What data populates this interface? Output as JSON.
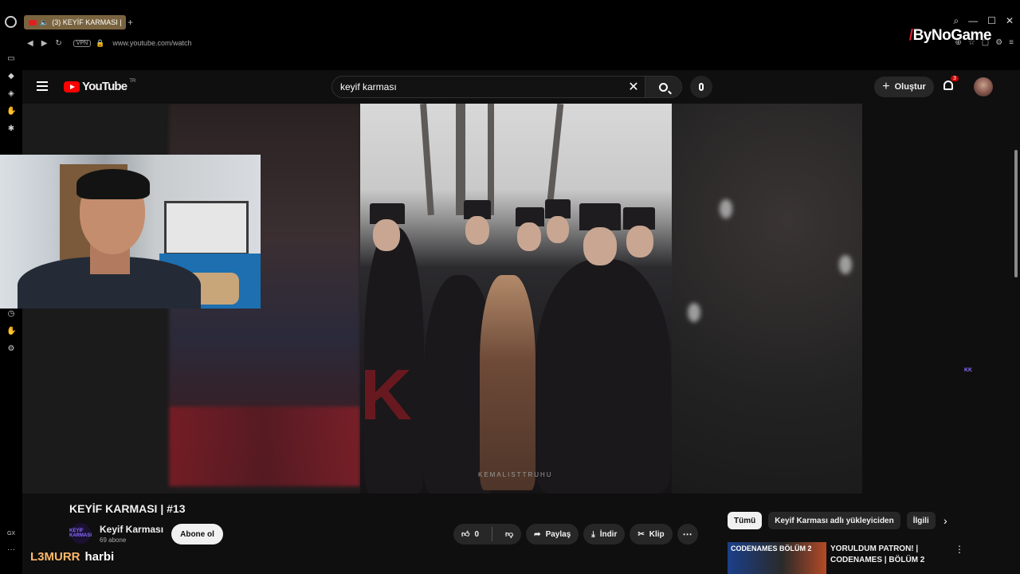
{
  "browser": {
    "tab_title": "(3) KEYİF KARMASI |",
    "url": "www.youtube.com/watch",
    "vpn_label": "VPN",
    "watermark": "ByNoGame",
    "rail_labels": [
      "GX",
      "···"
    ]
  },
  "youtube": {
    "logo_text": "YouTube",
    "country": "TR",
    "search_query": "keyif karması",
    "create_label": "Oluştur",
    "notification_count": "3"
  },
  "video": {
    "title": "KEYİF KARMASI | #13",
    "watermark": "KEMALISTTRUHU",
    "channel_name": "Keyif Karması",
    "channel_logo_text": "KEYİF KARMASI",
    "subscribers": "69 abone",
    "subscribe_label": "Abone ol",
    "like_count": "0",
    "share_label": "Paylaş",
    "download_label": "İndir",
    "clip_label": "Klip"
  },
  "sidebar": {
    "chips": [
      "Tümü",
      "Keyif Karması adlı yükleyiciden",
      "İlgili"
    ],
    "recommendation": {
      "thumb_text": "CODENAMES BÖLÜM 2",
      "title": "YORULDUM PATRON! | CODENAMES | BÖLÜM 2"
    }
  },
  "chat": {
    "user": "L3MURR",
    "message": "harbi"
  },
  "colors": {
    "accent": "#ff0000",
    "background": "#0f0f0f",
    "chat_user": "#ffb86b"
  }
}
